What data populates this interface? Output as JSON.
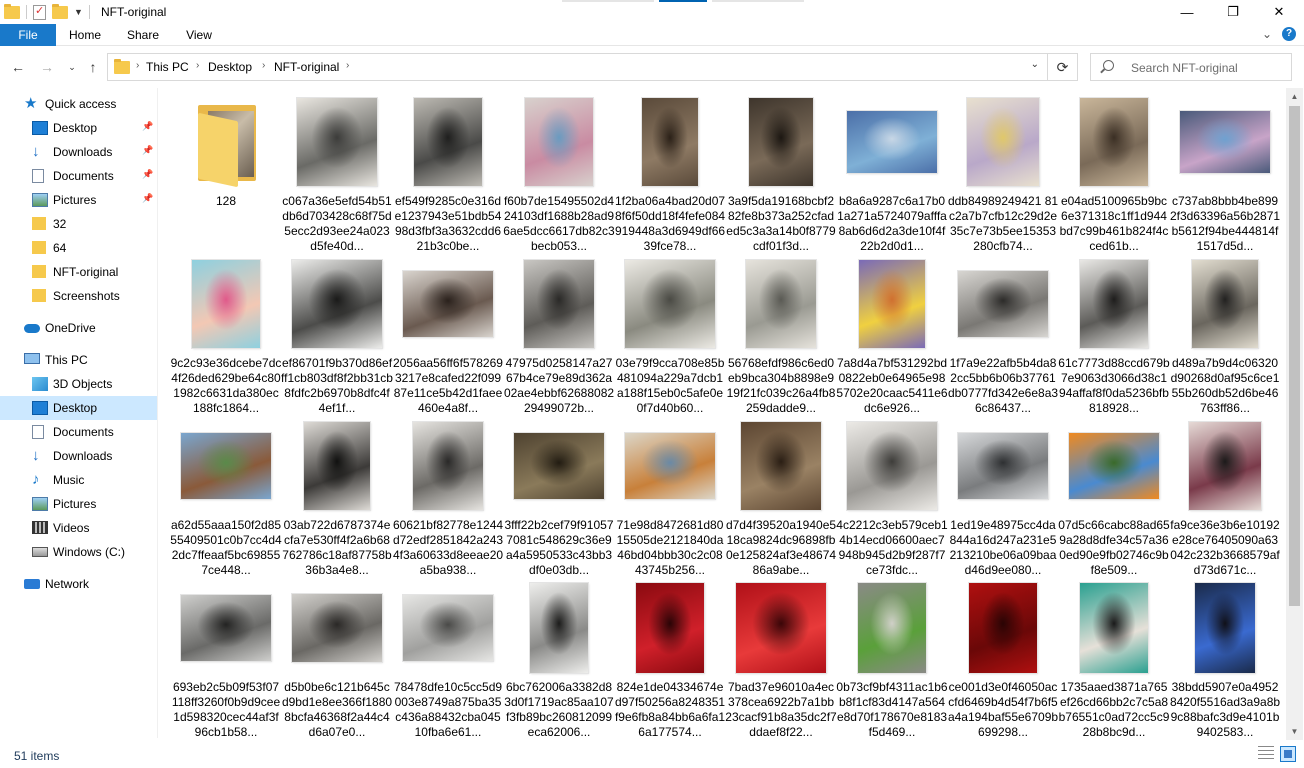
{
  "window": {
    "title": "NFT-original",
    "minimize": "—",
    "restore": "❐",
    "close": "✕"
  },
  "ribbon": {
    "tabs": [
      "File",
      "Home",
      "Share",
      "View"
    ],
    "expand": "⌄",
    "help": "?"
  },
  "address": {
    "crumbs": [
      "This PC",
      "Desktop",
      "NFT-original"
    ],
    "search_placeholder": "Search NFT-original"
  },
  "sidebar": {
    "items": [
      {
        "label": "Quick access",
        "icon": "star-icon",
        "pinned": false
      },
      {
        "label": "Desktop",
        "icon": "desktop-icon",
        "pinned": true
      },
      {
        "label": "Downloads",
        "icon": "download-icon",
        "pinned": true
      },
      {
        "label": "Documents",
        "icon": "documents-icon",
        "pinned": true
      },
      {
        "label": "Pictures",
        "icon": "pictures-icon",
        "pinned": true
      },
      {
        "label": "32",
        "icon": "folder-icon",
        "pinned": false
      },
      {
        "label": "64",
        "icon": "folder-icon",
        "pinned": false
      },
      {
        "label": "NFT-original",
        "icon": "folder-icon",
        "pinned": false
      },
      {
        "label": "Screenshots",
        "icon": "folder-icon",
        "pinned": false
      },
      {
        "label": "OneDrive",
        "icon": "cloud-icon",
        "pinned": false
      },
      {
        "label": "This PC",
        "icon": "computer-icon",
        "pinned": false
      },
      {
        "label": "3D Objects",
        "icon": "cube-icon",
        "pinned": false
      },
      {
        "label": "Desktop",
        "icon": "desktop-icon",
        "pinned": false,
        "selected": true
      },
      {
        "label": "Documents",
        "icon": "documents-icon",
        "pinned": false
      },
      {
        "label": "Downloads",
        "icon": "download-icon",
        "pinned": false
      },
      {
        "label": "Music",
        "icon": "music-icon",
        "pinned": false
      },
      {
        "label": "Pictures",
        "icon": "pictures-icon",
        "pinned": false
      },
      {
        "label": "Videos",
        "icon": "videos-icon",
        "pinned": false
      },
      {
        "label": "Windows (C:)",
        "icon": "drive-icon",
        "pinned": false
      },
      {
        "label": "Network",
        "icon": "network-icon",
        "pinned": false
      }
    ]
  },
  "files": [
    {
      "name": "128",
      "type": "folder"
    },
    {
      "name": "c067a36e5efd54b51db6d703428c68f75d5ecc2d93ee24a023d5fe40d...",
      "type": "image",
      "colors": [
        "#e9e6e0",
        "#6a6a66",
        "#3c3c3a"
      ]
    },
    {
      "name": "ef549f9285c0e316de1237943e51bdb5498d3fbf3a3632cdd621b3c0be...",
      "type": "image",
      "colors": [
        "#bdbab3",
        "#4a4a48",
        "#1f1f1e"
      ]
    },
    {
      "name": "f60b7de15495502d424103df1688b28ad96ae5dcc6617db82c3becb053...",
      "type": "image",
      "colors": [
        "#d8d1cd",
        "#c98ba2",
        "#6a9bc0"
      ]
    },
    {
      "name": "1f2ba06a4bad20d078f6f50dd18f4fefe084919448a3d6949df6639fce78...",
      "type": "image",
      "colors": [
        "#5a4a3a",
        "#8e7a64",
        "#2b2118"
      ]
    },
    {
      "name": "3a9f5da19168bcbf282fe8b373a252cfaded5c3a3a14b0f8779cdf01f3d...",
      "type": "image",
      "colors": [
        "#3e352c",
        "#7a6a58",
        "#1c1712"
      ]
    },
    {
      "name": "b8a6a9287c6a17b01a271a5724079afffa8ab6d6d2a3de10f4f22b2d0d1...",
      "type": "image",
      "colors": [
        "#4b6fa8",
        "#7fb0d6",
        "#c8d7e6"
      ]
    },
    {
      "name": "ddb84989249421 81c2a7b7cfb12c29d2e35c7e73b5ee15353280cfb74...",
      "type": "image",
      "colors": [
        "#e8e0cf",
        "#b9a8c9",
        "#e0c86a"
      ]
    },
    {
      "name": "e04ad5100965b9bc6e371318c1ff1d944bd7c99b461b824f4cced61b...",
      "type": "image",
      "colors": [
        "#c9b69a",
        "#7a6a58",
        "#3b2f24"
      ]
    },
    {
      "name": "c737ab8bbb4be8992f3d63396a56b2871b5612f94be444814f1517d5d...",
      "type": "image",
      "colors": [
        "#4a5a7a",
        "#c8a4c8",
        "#6fa1d0"
      ]
    },
    {
      "name": "9c2c93e36dcebe7dc4f26ded629be64c801982c6631da380ec188fc1864...",
      "type": "image",
      "colors": [
        "#8ed0df",
        "#f3c8b4",
        "#e05a8a"
      ]
    },
    {
      "name": "ef86701f9b370d86efff1cb803df8f2bb31cb8fdfc2b6970b8dfc4f4ef1f...",
      "type": "image",
      "colors": [
        "#ececea",
        "#4c4c4a",
        "#1a1a19"
      ]
    },
    {
      "name": "2056aa56ff6f5782693217e8cafed22f09987e11ce5b42d1faee460e4a8f...",
      "type": "image",
      "colors": [
        "#d9d4ce",
        "#6a5a50",
        "#2a211c"
      ]
    },
    {
      "name": "47975d0258147a2767b4ce79e89d362a02ae4ebbf6268808229499072b...",
      "type": "image",
      "colors": [
        "#c9c7c3",
        "#5e5c58",
        "#2a2927"
      ]
    },
    {
      "name": "03e79f9cca708e85b481094a229a7dcb1a188f15eb0c5afe0e0f7d40b60...",
      "type": "image",
      "colors": [
        "#eceae4",
        "#8a8a80",
        "#4a4a44"
      ]
    },
    {
      "name": "56768efdf986c6ed0eb9bca304b8898e919f21fc039c26a4fb8259dadde9...",
      "type": "image",
      "colors": [
        "#e6e3dc",
        "#9a9a92",
        "#5a5a54"
      ]
    },
    {
      "name": "7a8d4a7bf531292bd0822eb0e64965e985702e20caac5411e6dc6e926...",
      "type": "image",
      "colors": [
        "#7a6ab8",
        "#f0d040",
        "#d07030"
      ]
    },
    {
      "name": "1f7a9e22afb5b4da82cc5bb6b06b37761db0777fd342e6e8a36c86437...",
      "type": "image",
      "colors": [
        "#d8d6d2",
        "#7a7874",
        "#2c2b29"
      ]
    },
    {
      "name": "61c7773d88ccd679b7e9063d3066d38c194affaf8f0da5236bfb818928...",
      "type": "image",
      "colors": [
        "#e9e8e5",
        "#5c5b58",
        "#1e1d1c"
      ]
    },
    {
      "name": "d489a7b9d4c06320d90268d0af95c6ce155b260db52d6be46763ff86...",
      "type": "image",
      "colors": [
        "#e2ddd0",
        "#6a665e",
        "#222120"
      ]
    },
    {
      "name": "a62d55aaa150f2d8555409501c0b7cc4d42dc7ffeaaf5bc698557ce448...",
      "type": "image",
      "colors": [
        "#7aa6cf",
        "#8a5a3a",
        "#5a8a4a"
      ]
    },
    {
      "name": "03ab722d6787374ecfa7e530ff4f2a6b68762786c18af87758b36b3a4e8...",
      "type": "image",
      "colors": [
        "#dedbd6",
        "#3c3a38",
        "#111110"
      ]
    },
    {
      "name": "60621bf82778e1244d72edf2851842a2434f3a60633d8eeae20a5ba938...",
      "type": "image",
      "colors": [
        "#e6e4e0",
        "#6c6a66",
        "#2a2928"
      ]
    },
    {
      "name": "3fff22b2cef79f910577081c548629c36e9a4a5950533c43bb3df0e03db...",
      "type": "image",
      "colors": [
        "#4e4230",
        "#8a7a5a",
        "#221c12"
      ]
    },
    {
      "name": "71e98d8472681d8015505de2121840da46bd04bbb30c2c0843745b256...",
      "type": "image",
      "colors": [
        "#dcd6c8",
        "#c8803a",
        "#6a8aa6"
      ]
    },
    {
      "name": "d7d4f39520a1940e518ca9824dc96898fb0e125824af3e4867486a9abe...",
      "type": "image",
      "colors": [
        "#5c4632",
        "#9a8264",
        "#2a1e14"
      ]
    },
    {
      "name": "4c2212c3eb579ceb14b14ecd06600aec7948b945d2b9f287f7ce73fdc...",
      "type": "image",
      "colors": [
        "#eceae6",
        "#9a9894",
        "#3e3d3a"
      ]
    },
    {
      "name": "1ed19e48975cc4da844a16d247a231e5213210be06a09baad46d9ee080...",
      "type": "image",
      "colors": [
        "#d6d8da",
        "#7a7c7e",
        "#2e3032"
      ]
    },
    {
      "name": "07d5c66cabc88ad659a28d8dfe34c57a360ed90e9fb02746c9bf8e509...",
      "type": "image",
      "colors": [
        "#f08a20",
        "#4a8ad0",
        "#3a6a2a"
      ]
    },
    {
      "name": "fa9ce36e3b6e10192e28ce76405090a63042c232b3668579afd73d671c...",
      "type": "image",
      "colors": [
        "#e6dad6",
        "#7a3a4a",
        "#1c1a1a"
      ]
    },
    {
      "name": "693eb2c5b09f53f07118ff3260f0b9d9cee1d598320cec44af3f96cb1b58...",
      "type": "image",
      "colors": [
        "#cfcfcd",
        "#6a6a68",
        "#232322"
      ]
    },
    {
      "name": "d5b0be6c121b645cd9bd1e8ee366f18808bcfa46368f2a44c4d6a07e0...",
      "type": "image",
      "colors": [
        "#d2d0cc",
        "#6a6864",
        "#2a2826"
      ]
    },
    {
      "name": "78478dfe10c5cc5d9003e8749a875ba35c436a88432cba04510fba6e61...",
      "type": "image",
      "colors": [
        "#e6e6e4",
        "#a0a09e",
        "#4a4a48"
      ]
    },
    {
      "name": "6bc762006a3382d83d0f1719ac85aa107f3fb89bc260812099eca62006...",
      "type": "image",
      "colors": [
        "#eeeeec",
        "#8a8a88",
        "#1c1c1b"
      ]
    },
    {
      "name": "824e1de04334674ed97f50256a8248351f9e6fb8a84bb6a6fa16a177574...",
      "type": "image",
      "colors": [
        "#8a0a10",
        "#d0202a",
        "#2a0406"
      ]
    },
    {
      "name": "7bad37e96010a4ec378cea6922b7a1bb23cacf91b8a35dc2f7ddaef8f22...",
      "type": "image",
      "colors": [
        "#b01018",
        "#e83a3a",
        "#3a0608"
      ]
    },
    {
      "name": "0b73cf9bf4311ac1b6b8f1cf83d4147a564e8d70f178670e8183f5d469...",
      "type": "image",
      "colors": [
        "#8a8a86",
        "#5aa03a",
        "#d0d0c8"
      ]
    },
    {
      "name": "ce001d3e0f46050accfd6469b4d54f7b6f5a4a194baf55e6709b699298...",
      "type": "image",
      "colors": [
        "#b01010",
        "#6a0808",
        "#2a0404"
      ]
    },
    {
      "name": "1735aaed3871a765ef26cd66bb2c7c5a8b76551c0ad72cc5c928b8bc9d...",
      "type": "image",
      "colors": [
        "#2aa090",
        "#e6e0d8",
        "#1a1a1a"
      ]
    },
    {
      "name": "38bdd5907e0a49528420f5516ad3a9a8b9c88bafc3d9e4101b9402583...",
      "type": "image",
      "colors": [
        "#1a2a4a",
        "#3a6ad0",
        "#101018"
      ]
    }
  ],
  "status": {
    "item_count": "51 items"
  }
}
